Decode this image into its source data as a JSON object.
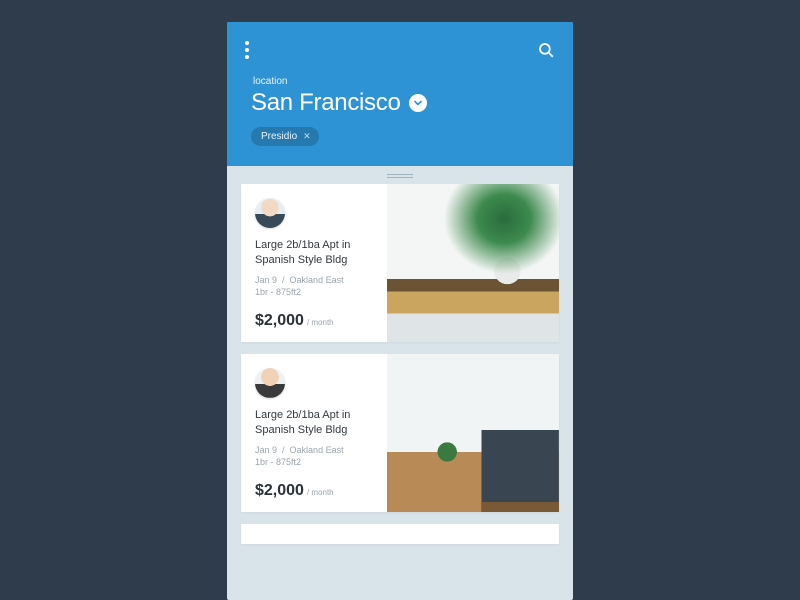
{
  "header": {
    "location_label": "location",
    "location_value": "San Francisco",
    "filters": [
      {
        "label": "Presidio"
      }
    ]
  },
  "listings": [
    {
      "title": "Large 2b/1ba Apt in Spanish Style Bldg",
      "date": "Jan 9",
      "area": "Oakland East",
      "specs": "1br - 875ft2",
      "price": "$2,000",
      "per": "/ month"
    },
    {
      "title": "Large 2b/1ba Apt in Spanish Style Bldg",
      "date": "Jan 9",
      "area": "Oakland East",
      "specs": "1br - 875ft2",
      "price": "$2,000",
      "per": "/ month"
    }
  ]
}
